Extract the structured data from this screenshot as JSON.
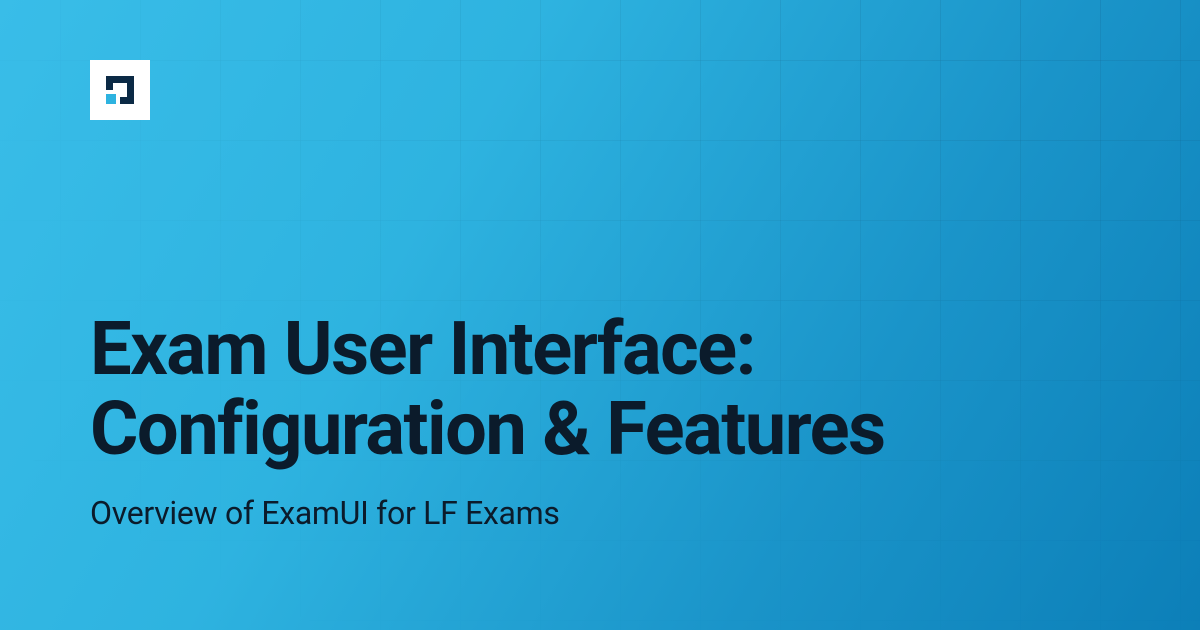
{
  "logo": {
    "name": "linux-foundation-square-icon"
  },
  "title_line1": "Exam User Interface:",
  "title_line2": "Configuration & Features",
  "subtitle": "Overview of ExamUI for LF Exams",
  "colors": {
    "bg_start": "#39bde8",
    "bg_end": "#0c7fb8",
    "text": "#0b1b2b",
    "logo_bg": "#ffffff",
    "logo_dark": "#0b2a45",
    "logo_accent": "#2eb3e0"
  }
}
